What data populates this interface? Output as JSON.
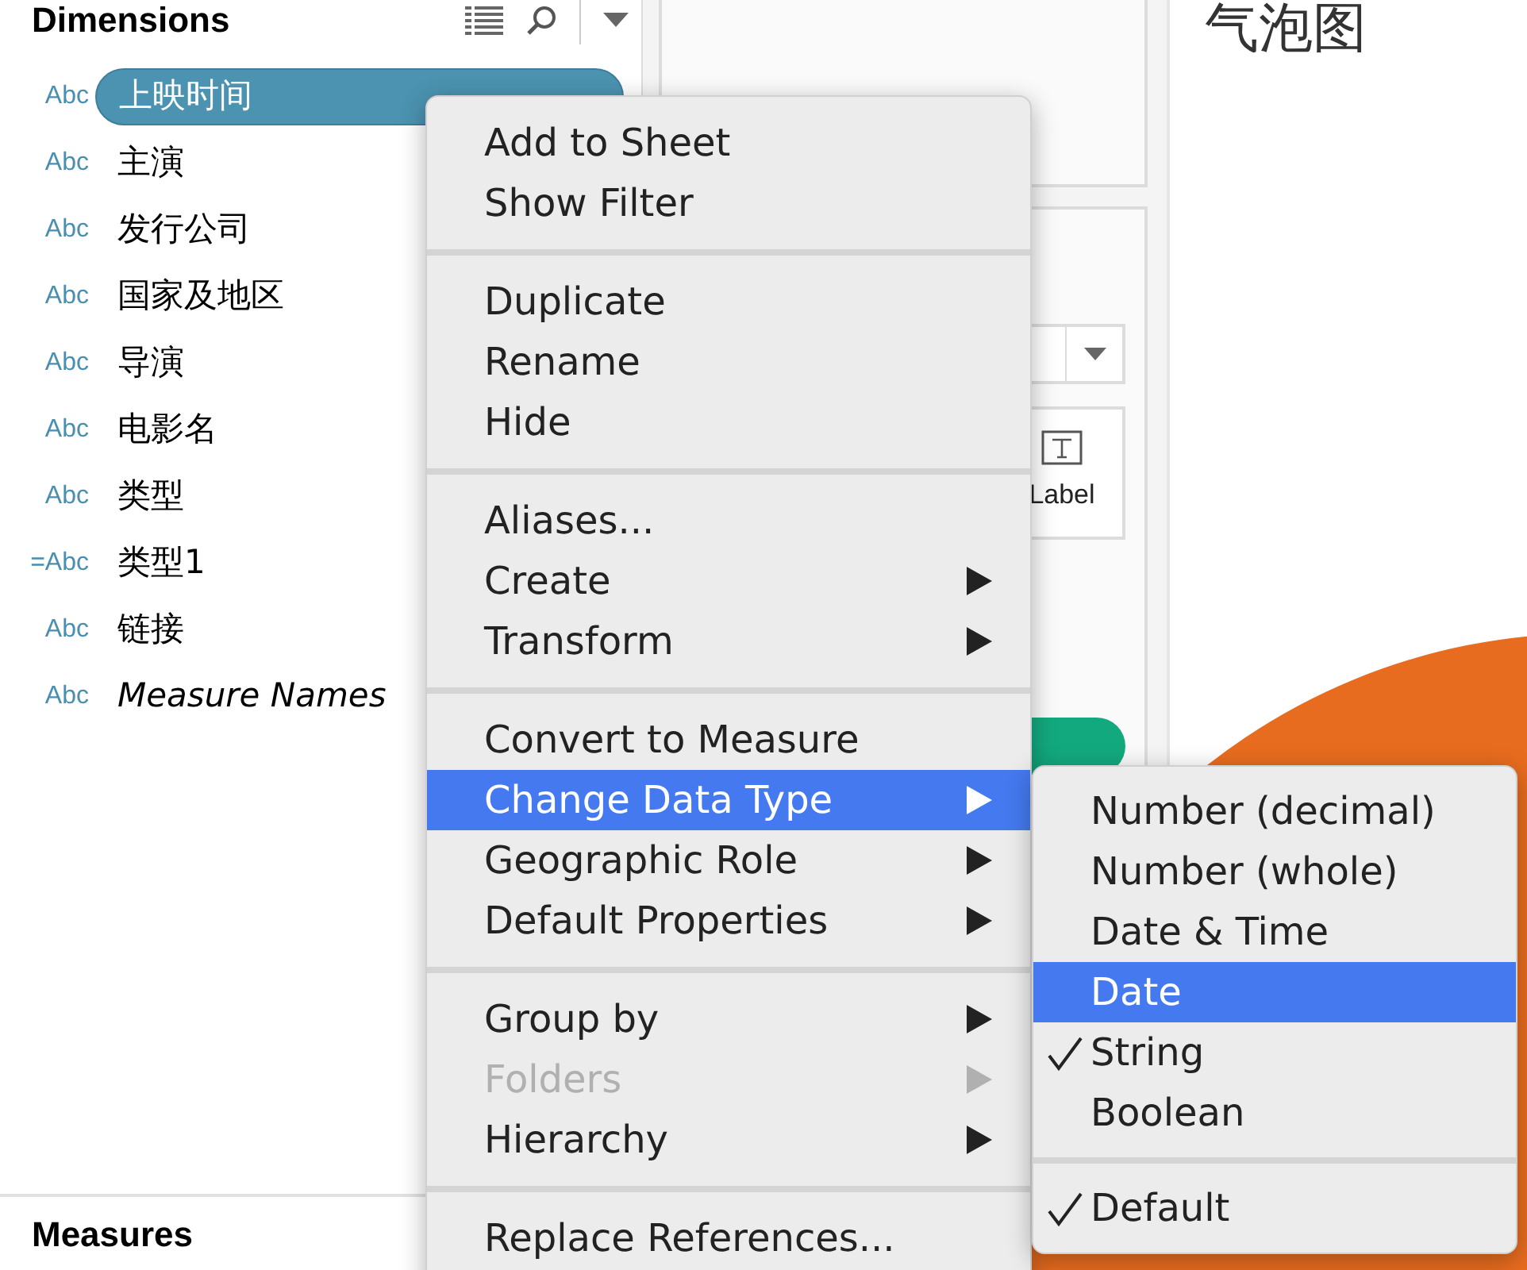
{
  "data_pane": {
    "dimensions_title": "Dimensions",
    "fields": [
      {
        "type_label": "Abc",
        "name": "上映时间",
        "selected": true,
        "italic": false
      },
      {
        "type_label": "Abc",
        "name": "主演",
        "selected": false,
        "italic": false
      },
      {
        "type_label": "Abc",
        "name": "发行公司",
        "selected": false,
        "italic": false
      },
      {
        "type_label": "Abc",
        "name": "国家及地区",
        "selected": false,
        "italic": false
      },
      {
        "type_label": "Abc",
        "name": "导演",
        "selected": false,
        "italic": false
      },
      {
        "type_label": "Abc",
        "name": "电影名",
        "selected": false,
        "italic": false
      },
      {
        "type_label": "Abc",
        "name": "类型",
        "selected": false,
        "italic": false
      },
      {
        "type_label": "=Abc",
        "name": "类型1",
        "selected": false,
        "italic": false
      },
      {
        "type_label": "Abc",
        "name": "链接",
        "selected": false,
        "italic": false
      },
      {
        "type_label": "Abc",
        "name": "Measure Names",
        "selected": false,
        "italic": true
      }
    ],
    "measures_title": "Measures"
  },
  "marks_card": {
    "label_button": "Label"
  },
  "sheet": {
    "title": "气泡图"
  },
  "context_menu": {
    "groups": [
      {
        "items": [
          {
            "label": "Add to Sheet",
            "submenu": false,
            "disabled": false,
            "selected": false
          },
          {
            "label": "Show Filter",
            "submenu": false,
            "disabled": false,
            "selected": false
          }
        ]
      },
      {
        "items": [
          {
            "label": "Duplicate",
            "submenu": false,
            "disabled": false,
            "selected": false
          },
          {
            "label": "Rename",
            "submenu": false,
            "disabled": false,
            "selected": false
          },
          {
            "label": "Hide",
            "submenu": false,
            "disabled": false,
            "selected": false
          }
        ]
      },
      {
        "items": [
          {
            "label": "Aliases...",
            "submenu": false,
            "disabled": false,
            "selected": false
          },
          {
            "label": "Create",
            "submenu": true,
            "disabled": false,
            "selected": false
          },
          {
            "label": "Transform",
            "submenu": true,
            "disabled": false,
            "selected": false
          }
        ]
      },
      {
        "items": [
          {
            "label": "Convert to Measure",
            "submenu": false,
            "disabled": false,
            "selected": false
          },
          {
            "label": "Change Data Type",
            "submenu": true,
            "disabled": false,
            "selected": true
          },
          {
            "label": "Geographic Role",
            "submenu": true,
            "disabled": false,
            "selected": false
          },
          {
            "label": "Default Properties",
            "submenu": true,
            "disabled": false,
            "selected": false
          }
        ]
      },
      {
        "items": [
          {
            "label": "Group by",
            "submenu": true,
            "disabled": false,
            "selected": false
          },
          {
            "label": "Folders",
            "submenu": true,
            "disabled": true,
            "selected": false
          },
          {
            "label": "Hierarchy",
            "submenu": true,
            "disabled": false,
            "selected": false
          }
        ]
      },
      {
        "items": [
          {
            "label": "Replace References...",
            "submenu": false,
            "disabled": false,
            "selected": false
          }
        ]
      }
    ]
  },
  "submenu": {
    "groups": [
      {
        "items": [
          {
            "label": "Number (decimal)",
            "selected": false,
            "checked": false
          },
          {
            "label": "Number (whole)",
            "selected": false,
            "checked": false
          },
          {
            "label": "Date & Time",
            "selected": false,
            "checked": false
          },
          {
            "label": "Date",
            "selected": true,
            "checked": false
          },
          {
            "label": "String",
            "selected": false,
            "checked": true
          },
          {
            "label": "Boolean",
            "selected": false,
            "checked": false
          }
        ]
      },
      {
        "items": [
          {
            "label": "Default",
            "selected": false,
            "checked": true
          }
        ]
      }
    ]
  }
}
